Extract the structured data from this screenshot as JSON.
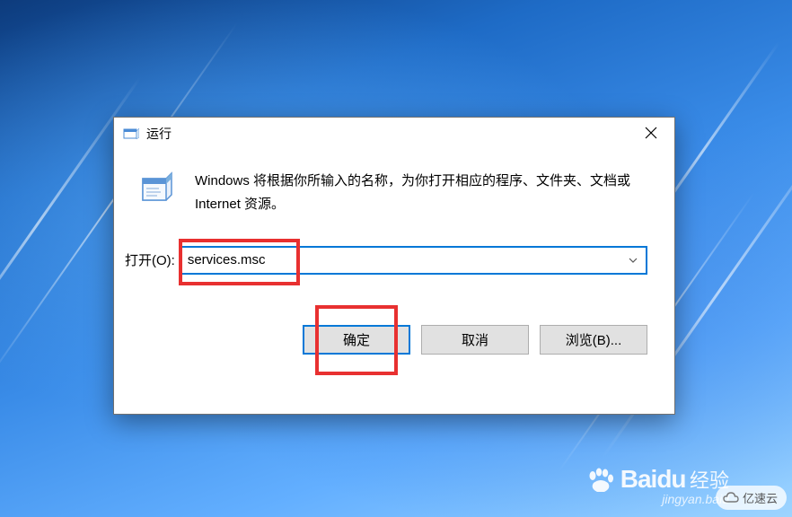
{
  "dialog": {
    "title": "运行",
    "description": "Windows 将根据你所输入的名称，为你打开相应的程序、文件夹、文档或 Internet 资源。",
    "open_label": "打开(O):",
    "input_value": "services.msc",
    "buttons": {
      "ok": "确定",
      "cancel": "取消",
      "browse": "浏览(B)..."
    }
  },
  "watermark": {
    "brand": "Bai",
    "brand2": "du",
    "suffix": "经验",
    "sub": "jingyan.baid",
    "yisu": "亿速云"
  }
}
